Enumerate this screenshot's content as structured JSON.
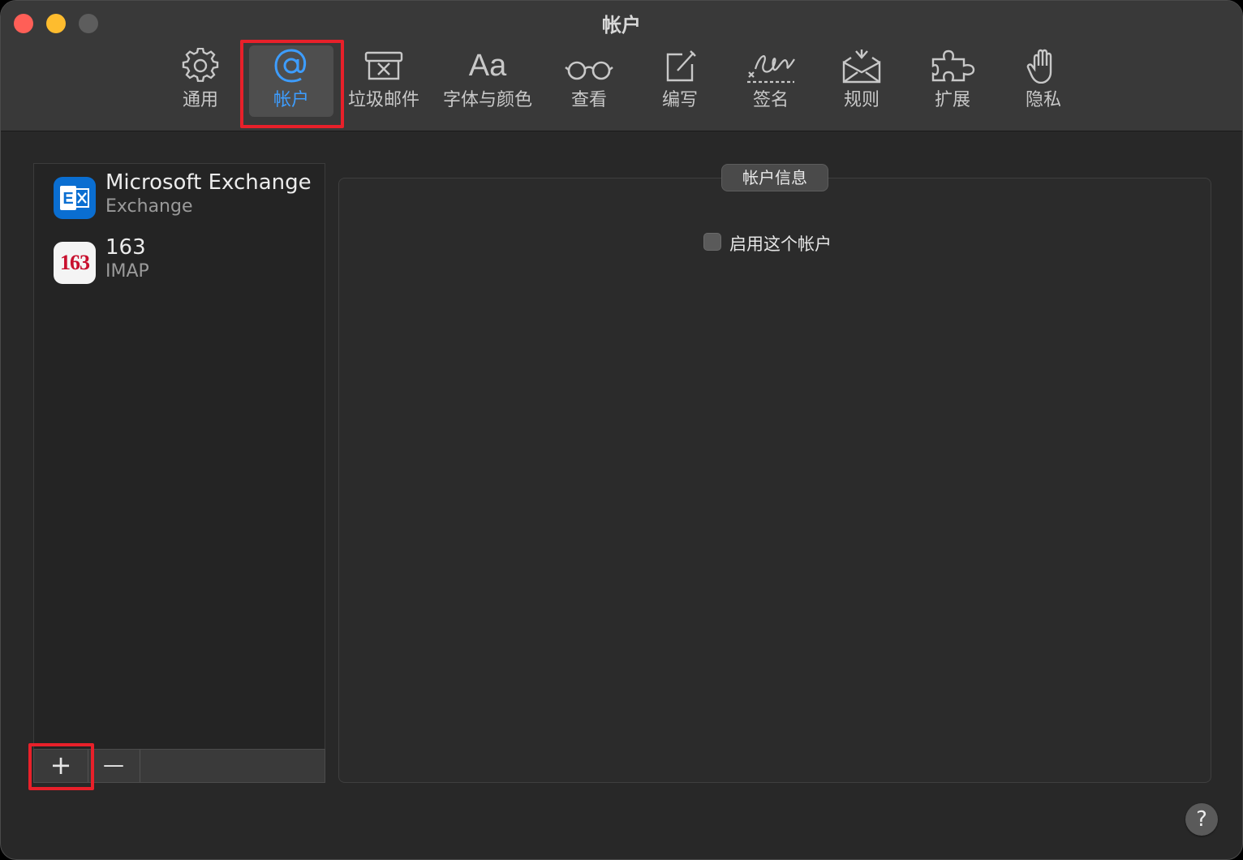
{
  "window": {
    "title": "帐户"
  },
  "colors": {
    "accent": "#3d9dff",
    "highlight": "#e8202a",
    "close": "#ff5f57",
    "minimize": "#febc2e"
  },
  "toolbar": {
    "tabs": [
      {
        "label": "通用",
        "icon": "gear-icon"
      },
      {
        "label": "帐户",
        "icon": "at-sign-icon",
        "active": true
      },
      {
        "label": "垃圾邮件",
        "icon": "junk-tray-icon"
      },
      {
        "label": "字体与颜色",
        "icon": "Aa",
        "glyph": "Aa"
      },
      {
        "label": "查看",
        "icon": "glasses-icon"
      },
      {
        "label": "编写",
        "icon": "compose-icon"
      },
      {
        "label": "签名",
        "icon": "signature-icon"
      },
      {
        "label": "规则",
        "icon": "rules-envelope-icon"
      },
      {
        "label": "扩展",
        "icon": "puzzle-icon"
      },
      {
        "label": "隐私",
        "icon": "hand-icon"
      }
    ]
  },
  "accounts": [
    {
      "name": "Microsoft Exchange",
      "type": "Exchange",
      "icon": "exchange-icon"
    },
    {
      "name": "163",
      "type": "IMAP",
      "icon": "netease-163-icon",
      "icon_text": "163"
    }
  ],
  "list_toolbar": {
    "add_label": "+",
    "remove_label": "—"
  },
  "account_info": {
    "title": "帐户信息",
    "enable_label": "启用这个帐户",
    "enabled": false
  },
  "help": {
    "label": "?"
  }
}
